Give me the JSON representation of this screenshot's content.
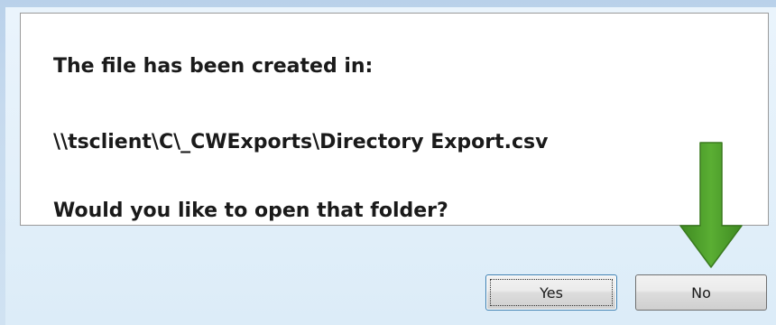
{
  "message": {
    "line1": "The file has been created in:",
    "line2": "\\\\tsclient\\C\\_CWExports\\Directory Export.csv",
    "line3": "Would you like to open that folder?"
  },
  "buttons": {
    "yes_label": "Yes",
    "no_label": "No"
  },
  "annotation": {
    "arrow_color": "#4e9a2a",
    "points_to": "no-button"
  }
}
